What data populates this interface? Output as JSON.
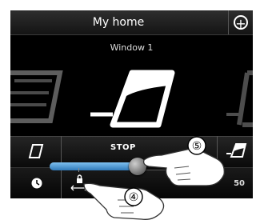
{
  "header": {
    "title": "My home",
    "add_icon": "plus-circle-icon"
  },
  "device": {
    "name": "Window 1"
  },
  "controls": {
    "open_label": "",
    "stop_label": "STOP",
    "position_value": "50",
    "position_fraction": 0.5
  },
  "callouts": {
    "stop_marker": "⑤",
    "lock_marker": "④"
  },
  "colors": {
    "accent": "#3f8fd6",
    "background": "#000000"
  }
}
